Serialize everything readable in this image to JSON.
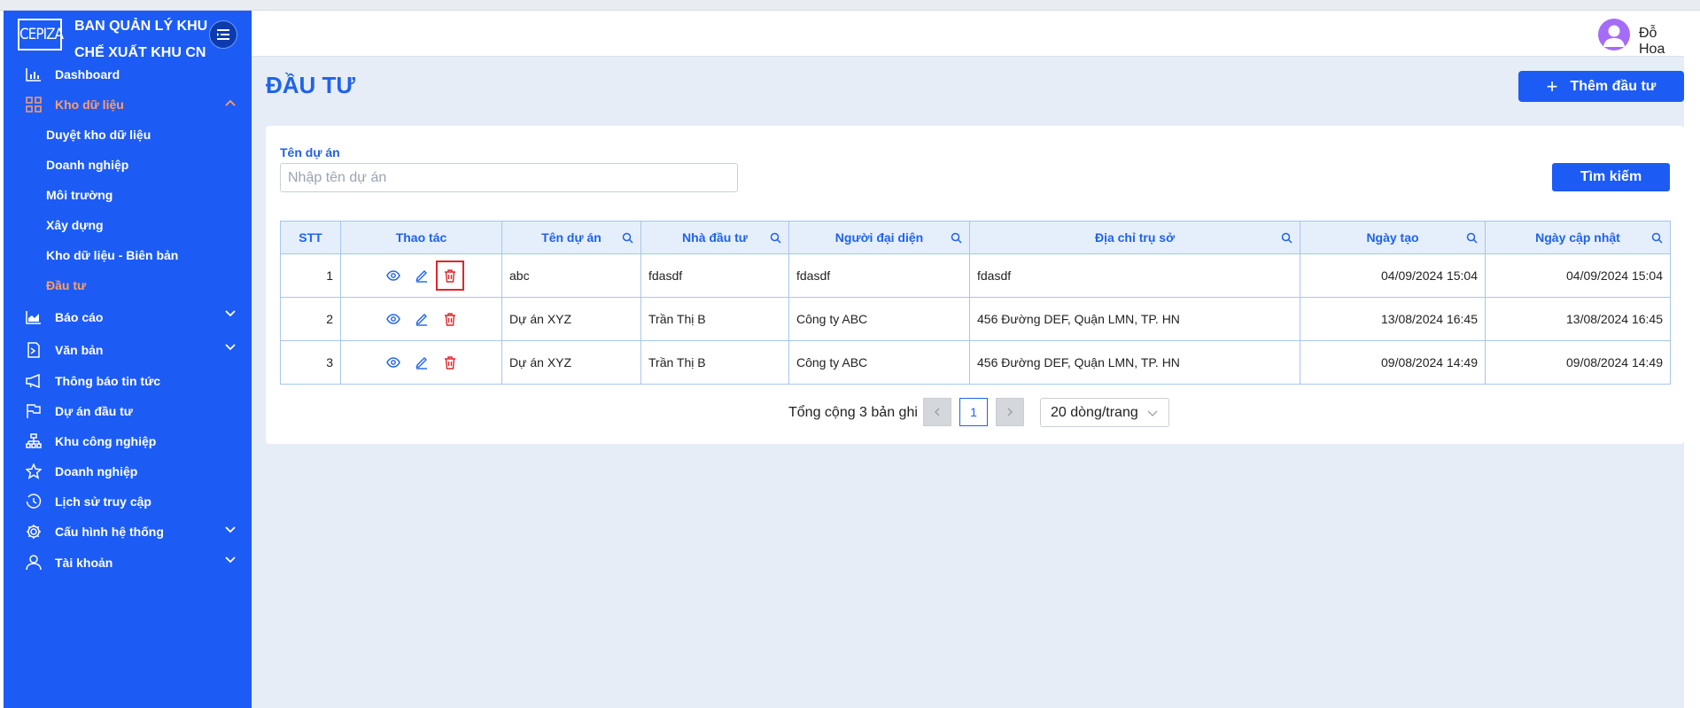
{
  "brand": {
    "logo_text": "CEPIZA",
    "title_line1": "BAN QUẢN LÝ KHU",
    "title_line2": "CHẾ XUẤT KHU CN"
  },
  "sidebar": {
    "items": [
      {
        "label": "Dashboard",
        "icon": "bar-chart-icon"
      },
      {
        "label": "Kho dữ liệu",
        "icon": "grid-icon",
        "expanded": true,
        "active": true
      },
      {
        "label": "Báo cáo",
        "icon": "area-chart-icon",
        "has_children": true
      },
      {
        "label": "Văn bản",
        "icon": "document-icon",
        "has_children": true
      },
      {
        "label": "Thông báo tin tức",
        "icon": "megaphone-icon"
      },
      {
        "label": "Dự án đầu tư",
        "icon": "flag-icon"
      },
      {
        "label": "Khu công nghiệp",
        "icon": "cluster-icon"
      },
      {
        "label": "Doanh nghiệp",
        "icon": "star-icon"
      },
      {
        "label": "Lịch sử truy cập",
        "icon": "history-icon"
      },
      {
        "label": "Cấu hình hệ thống",
        "icon": "gear-icon",
        "has_children": true
      },
      {
        "label": "Tài khoản",
        "icon": "user-icon",
        "has_children": true
      }
    ],
    "subitems": [
      {
        "label": "Duyệt kho dữ liệu"
      },
      {
        "label": "Doanh nghiệp"
      },
      {
        "label": "Môi trường"
      },
      {
        "label": "Xây dựng"
      },
      {
        "label": "Kho dữ liệu - Biên bản"
      },
      {
        "label": "Đầu tư",
        "active": true
      }
    ]
  },
  "header": {
    "username": "Đỗ Hoa"
  },
  "main": {
    "title": "ĐẦU TƯ",
    "add_button": "Thêm đầu tư",
    "filter": {
      "label": "Tên dự án",
      "placeholder": "Nhập tên dự án",
      "search_button": "Tìm kiếm"
    },
    "table": {
      "columns": [
        "STT",
        "Thao tác",
        "Tên dự án",
        "Nhà đầu tư",
        "Người đại diện",
        "Địa chỉ trụ sở",
        "Ngày tạo",
        "Ngày cập nhật"
      ],
      "rows": [
        {
          "stt": "1",
          "ten_du_an": "abc",
          "nha_dau_tu": "fdasdf",
          "nguoi_dai_dien": "fdasdf",
          "dia_chi": "fdasdf",
          "ngay_tao": "04/09/2024 15:04",
          "ngay_cap_nhat": "04/09/2024 15:04"
        },
        {
          "stt": "2",
          "ten_du_an": "Dự án XYZ",
          "nha_dau_tu": "Trần Thị B",
          "nguoi_dai_dien": "Công ty ABC",
          "dia_chi": "456 Đường DEF, Quận LMN, TP. HN",
          "ngay_tao": "13/08/2024 16:45",
          "ngay_cap_nhat": "13/08/2024 16:45"
        },
        {
          "stt": "3",
          "ten_du_an": "Dự án XYZ",
          "nha_dau_tu": "Trần Thị B",
          "nguoi_dai_dien": "Công ty ABC",
          "dia_chi": "456 Đường DEF, Quận LMN, TP. HN",
          "ngay_tao": "09/08/2024 14:49",
          "ngay_cap_nhat": "09/08/2024 14:49"
        }
      ]
    },
    "pagination": {
      "total_text": "Tổng cộng 3 bản ghi",
      "current_page": "1",
      "page_size": "20 dòng/trang"
    }
  },
  "colors": {
    "sidebar_bg": "#1c5cf5",
    "active_menu": "#ff9f66",
    "accent": "#1f63e9",
    "delete": "#e0262b"
  }
}
